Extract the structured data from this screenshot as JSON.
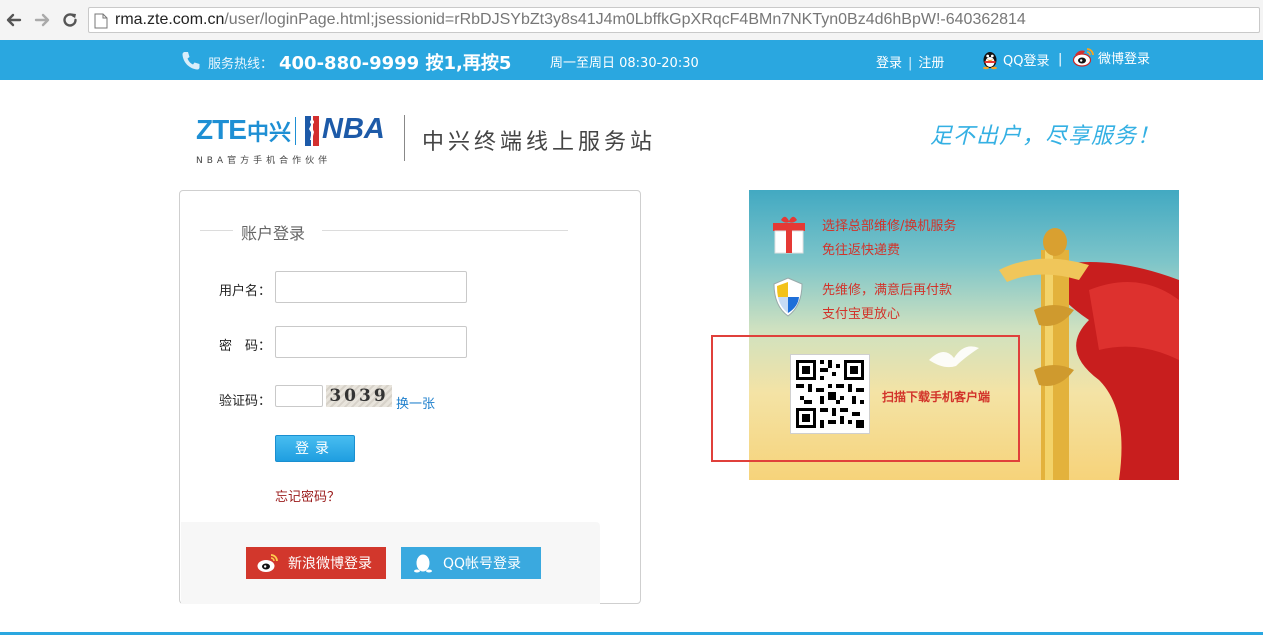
{
  "browser": {
    "url_host": "rma.zte.com.cn",
    "url_rest": "/user/loginPage.html;jsessionid=rRbDJSYbZt3y8s41J4m0LbffkGpXRqcF4BMn7NKTyn0Bz4d6hBpW!-640362814"
  },
  "topbar": {
    "hotline_label": "服务热线：",
    "hotline_number": "400-880-9999 按1,再按5",
    "hours": "周一至周日 08:30-20:30",
    "login": "登录",
    "separator": "|",
    "register": "注册",
    "qq_login": "QQ登录",
    "weibo_login": "微博登录"
  },
  "header": {
    "logo_zte": "ZTE",
    "logo_zte_cn": "中兴",
    "logo_nba": "NBA",
    "logo_subtitle": "NBA官方手机合作伙伴",
    "site_title": "中兴终端线上服务站",
    "slogan": "足不出户，尽享服务！"
  },
  "login": {
    "title": "账户登录",
    "username_label": "用户名：",
    "username_value": "",
    "password_label": "密　码：",
    "password_value": "",
    "captcha_label": "验证码：",
    "captcha_value": "",
    "captcha_code": "3039",
    "refresh": "换一张",
    "submit": "登录",
    "forgot": "忘记密码？",
    "weibo_button": "新浪微博登录",
    "qq_button": "QQ帐号登录"
  },
  "promo": {
    "line1": "选择总部维修/换机服务",
    "line2": "免往返快递费",
    "line3": "先维修，满意后再付款",
    "line4": "支付宝更放心",
    "qr_caption": "扫描下载手机客户端"
  },
  "colors": {
    "topbar": "#2aa7e0",
    "accent_red": "#d2332a",
    "weibo_red": "#d2372c",
    "qq_blue": "#3aa9df",
    "highlight": "#e0403b"
  }
}
